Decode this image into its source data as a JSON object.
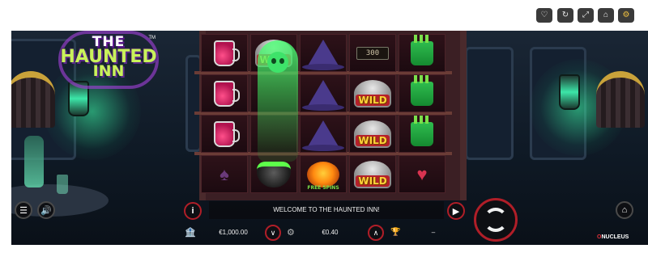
{
  "toolbar": {
    "icons": [
      "heart-icon",
      "refresh-icon",
      "expand-icon",
      "home-icon",
      "settings-icon"
    ]
  },
  "logo": {
    "line1": "THE",
    "line2": "HAUNTED",
    "line3": "INN",
    "tm": "TM"
  },
  "reels": {
    "counter": "300",
    "wild_label": "WILD",
    "free_spins_label": "FREE SPINS",
    "grid": [
      [
        "jar",
        "wild",
        "hat",
        "empty",
        "cup"
      ],
      [
        "jar",
        "ghost",
        "hat",
        "wild",
        "cup"
      ],
      [
        "jar",
        "ghost",
        "hat",
        "wild",
        "cup"
      ],
      [
        "spade",
        "cauldron",
        "pumpkin",
        "wild",
        "heart"
      ]
    ]
  },
  "message": "WELCOME TO THE HAUNTED INN!",
  "balance": "€1,000.00",
  "bet": "€0.40",
  "win": "–",
  "brand": {
    "o": "O",
    "name": "NUCLEUS"
  },
  "colors": {
    "accent_red": "#b01e28",
    "reel_bg": "#2e1219",
    "ghost_green": "#50ff78"
  }
}
